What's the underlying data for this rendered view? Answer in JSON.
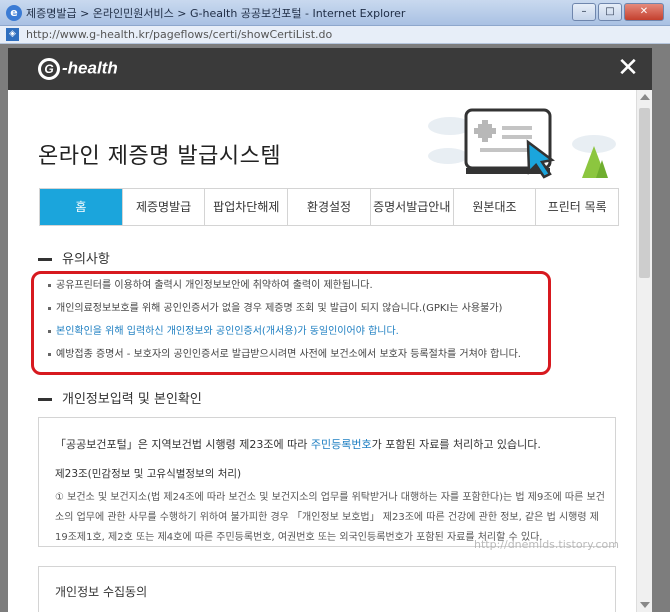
{
  "window": {
    "title": "제증명발급 > 온라인민원서비스 > G-health 공공보건포털 - Internet Explorer",
    "url": "http://www.g-health.kr/pageflows/certi/showCertiList.do"
  },
  "popup": {
    "logo": "-health",
    "title": "온라인 제증명 발급시스템",
    "tabs": [
      {
        "label": "홈",
        "active": true
      },
      {
        "label": "제증명발급",
        "active": false
      },
      {
        "label": "팝업차단해제",
        "active": false
      },
      {
        "label": "환경설정",
        "active": false
      },
      {
        "label": "증명서발급안내",
        "active": false
      },
      {
        "label": "원본대조",
        "active": false
      },
      {
        "label": "프린터 목록",
        "active": false
      }
    ],
    "notice": {
      "heading": "유의사항",
      "items": [
        "공유프린터를 이용하여 출력시 개인정보보안에 취약하여 출력이 제한됩니다.",
        "개인의료정보보호를 위해 공인인증서가 없을 경우 제증명 조회 및 발급이 되지 않습니다.(GPKI는 사용불가)",
        "본인확인을 위해 입력하신 개인정보와 공인인증서(개서용)가 동일인이어야 합니다.",
        "예방접종 증명서 - 보호자의 공인인증서로 발급받으시려면 사전에 보건소에서 보호자 등록절차를 거쳐야 합니다."
      ]
    },
    "personal": {
      "heading": "개인정보입력 및 본인확인",
      "lead_prefix": "「공공보건포털」은 지역보건법 시행령 제23조에 따라 ",
      "lead_highlight": "주민등록번호",
      "lead_suffix": "가 포함된 자료를 처리하고 있습니다.",
      "sub_title": "제23조(민감정보 및 고유식별정보의 처리)",
      "body": "① 보건소 및 보건지소(법 제24조에 따라 보건소 및 보건지소의 업무를 위탁받거나 대행하는 자를 포함한다)는 법 제9조에 따른 보건소의 업무에 관한 사무를 수행하기 위하여 불가피한 경우 「개인정보 보호법」 제23조에 따른 건강에 관한 정보, 같은 법 시행령 제19조제1호, 제2호 또는 제4호에 따른 주민등록번호, 여권번호 또는 외국인등록번호가 포함된 자료를 처리할 수 있다."
    },
    "collect": {
      "title": "개인정보 수집동의"
    },
    "watermark": "http://dnemlds.tistory.com"
  },
  "colors": {
    "tab_active": "#1ba5dc",
    "notice_border": "#d7191f",
    "link_blue": "#1e7fc2",
    "header_dark": "#3a3a3a"
  }
}
